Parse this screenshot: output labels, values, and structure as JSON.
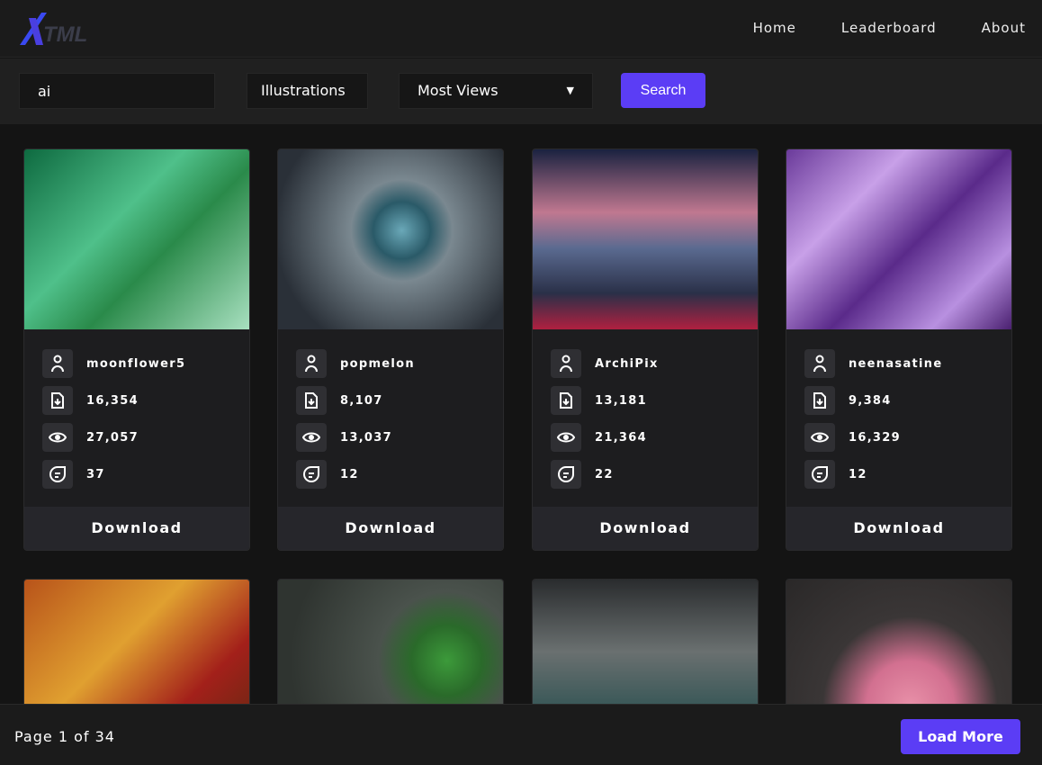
{
  "header": {
    "logo": "XTML",
    "nav": [
      "Home",
      "Leaderboard",
      "About"
    ]
  },
  "filters": {
    "search_value": "ai",
    "category": "Illustrations",
    "sort": "Most Views",
    "search_label": "Search"
  },
  "cards": [
    {
      "user": "moonflower5",
      "downloads": "16,354",
      "views": "27,057",
      "comments": "37",
      "download_label": "Download"
    },
    {
      "user": "popmelon",
      "downloads": "8,107",
      "views": "13,037",
      "comments": "12",
      "download_label": "Download"
    },
    {
      "user": "ArchiPix",
      "downloads": "13,181",
      "views": "21,364",
      "comments": "22",
      "download_label": "Download"
    },
    {
      "user": "neenasatine",
      "downloads": "9,384",
      "views": "16,329",
      "comments": "12",
      "download_label": "Download"
    }
  ],
  "footer": {
    "page": "Page 1 of 34",
    "load_more": "Load More"
  },
  "colors": {
    "accent": "#5b3df5"
  }
}
